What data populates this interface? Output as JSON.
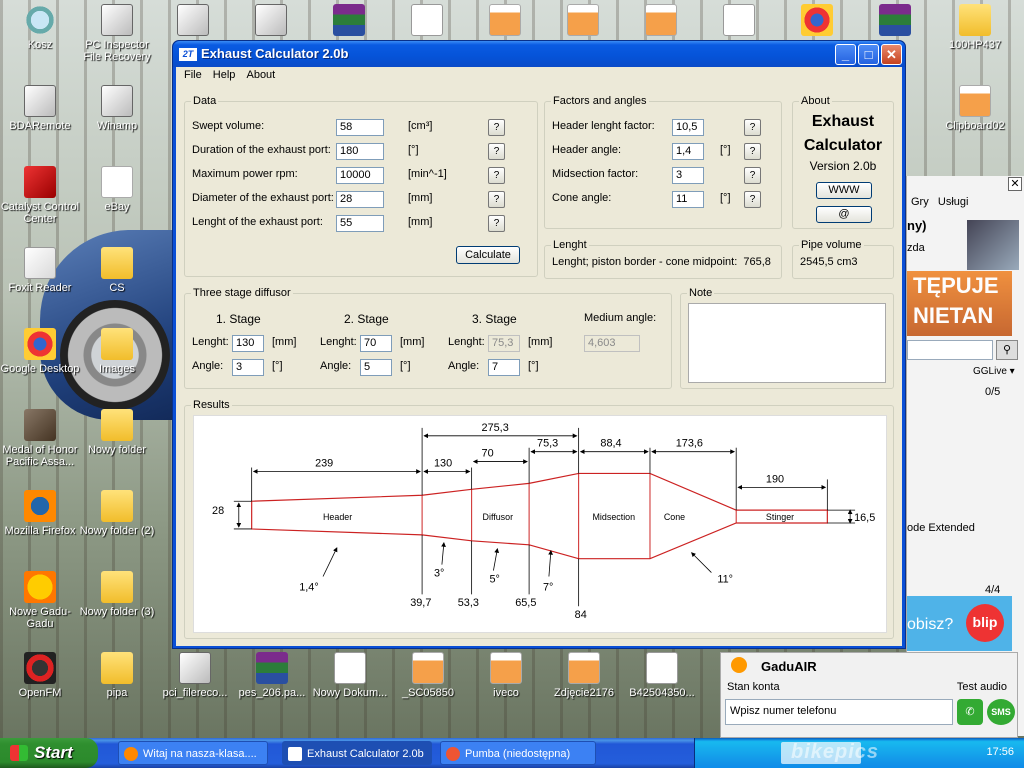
{
  "desktop": {
    "icons_left": [
      {
        "label": "Kosz"
      },
      {
        "label": "BDARemote"
      },
      {
        "label": "Catalyst Control Center"
      },
      {
        "label": "Foxit Reader"
      },
      {
        "label": "Google Desktop"
      },
      {
        "label": "Medal of Honor Pacific Assa..."
      },
      {
        "label": "Mozilla Firefox"
      },
      {
        "label": "Nowe Gadu-Gadu"
      },
      {
        "label": "OpenFM"
      }
    ],
    "icons_col2": [
      {
        "label": "PC Inspector File Recovery"
      },
      {
        "label": "Winamp"
      },
      {
        "label": "eBay"
      },
      {
        "label": "CS"
      },
      {
        "label": "Images"
      },
      {
        "label": "Nowy folder"
      },
      {
        "label": "Nowy folder (2)"
      },
      {
        "label": "Nowy folder (3)"
      },
      {
        "label": "pipa"
      }
    ],
    "icons_bottom": [
      {
        "label": "pci_filereco..."
      },
      {
        "label": "pes_206.pa..."
      },
      {
        "label": "Nowy Dokum..."
      },
      {
        "label": "_SC05850"
      },
      {
        "label": "iveco"
      },
      {
        "label": "Zdjęcie2176"
      },
      {
        "label": "B42504350..."
      }
    ],
    "icons_right": [
      {
        "label": "100HP437"
      },
      {
        "label": "Clipboard02"
      }
    ]
  },
  "window": {
    "title": "Exhaust Calculator 2.0b",
    "logo": "2T",
    "menu": [
      "File",
      "Help",
      "About"
    ],
    "data_group": {
      "legend": "Data",
      "rows": [
        {
          "label": "Swept volume:",
          "value": "58",
          "unit": "[cm³]"
        },
        {
          "label": "Duration of the exhaust port:",
          "value": "180",
          "unit": "[°]"
        },
        {
          "label": "Maximum power rpm:",
          "value": "10000",
          "unit": "[min^-1]"
        },
        {
          "label": "Diameter of the exhaust port:",
          "value": "28",
          "unit": "[mm]"
        },
        {
          "label": "Lenght of the exhaust port:",
          "value": "55",
          "unit": "[mm]"
        }
      ],
      "help_label": "?",
      "calculate_label": "Calculate"
    },
    "factors_group": {
      "legend": "Factors and angles",
      "rows": [
        {
          "label": "Header lenght factor:",
          "value": "10,5",
          "unit": ""
        },
        {
          "label": "Header angle:",
          "value": "1,4",
          "unit": "[°]"
        },
        {
          "label": "Midsection factor:",
          "value": "3",
          "unit": ""
        },
        {
          "label": "Cone angle:",
          "value": "11",
          "unit": "[°]"
        }
      ]
    },
    "about_group": {
      "legend": "About",
      "title_line1": "Exhaust",
      "title_line2": "Calculator",
      "version": "Version 2.0b",
      "www_label": "WWW",
      "email_label": "@"
    },
    "length_group": {
      "legend": "Lenght",
      "text": "Lenght; piston border - cone midpoint:  765,8"
    },
    "pipe_group": {
      "legend": "Pipe volume",
      "text": "2545,5 cm3"
    },
    "diffuser_group": {
      "legend": "Three stage diffusor",
      "stages": [
        {
          "title": "1. Stage",
          "length": "130",
          "angle": "3",
          "length_unit": "[mm]",
          "angle_unit": "[°]",
          "disabled": false
        },
        {
          "title": "2. Stage",
          "length": "70",
          "angle": "5",
          "length_unit": "[mm]",
          "angle_unit": "[°]",
          "disabled": false
        },
        {
          "title": "3. Stage",
          "length": "75,3",
          "angle": "7",
          "length_unit": "[mm]",
          "angle_unit": "[°]",
          "disabled": true
        }
      ],
      "length_label": "Lenght:",
      "angle_label": "Angle:",
      "medium_label": "Medium angle:",
      "medium_value": "4,603"
    },
    "note_group": {
      "legend": "Note",
      "text": ""
    },
    "results_group": {
      "legend": "Results",
      "diagram": {
        "dims_top": [
          "239",
          "130",
          "70",
          "75,3",
          "88,4",
          "173,6",
          "190",
          "275,3"
        ],
        "sections": [
          "Header",
          "Diffusor",
          "Midsection",
          "Cone",
          "Stinger"
        ],
        "left_dia": "28",
        "right_dia": "16,5",
        "angles": [
          "1,4°",
          "3°",
          "5°",
          "7°",
          "11°"
        ],
        "bottom_dias": [
          "39,7",
          "53,3",
          "65,5",
          "84"
        ]
      }
    }
  },
  "gg_panel": {
    "tabs": "Gry   Usługi",
    "name": "ny)",
    "sub": "zda",
    "banner": "TĘPUJE NIETAN",
    "ggl": "GGLive ▾",
    "count1": "0/5",
    "extended": "ode Extended",
    "count2": "4/4",
    "blip_text": "obisz?",
    "blip_badge": "blip"
  },
  "gaduair": {
    "title": "GaduAIR",
    "status_label": "Stan konta",
    "audio_label": "Test audio",
    "phone_placeholder": "Wpisz numer telefonu",
    "sms": "SMS"
  },
  "taskbar": {
    "start": "Start",
    "tasks": [
      {
        "label": "Witaj na nasza-klasa...."
      },
      {
        "label": "Exhaust Calculator 2.0b"
      },
      {
        "label": "Pumba (niedostępna)"
      }
    ],
    "lang": "PL",
    "clock": "17:56",
    "watermark": "bikepics"
  }
}
